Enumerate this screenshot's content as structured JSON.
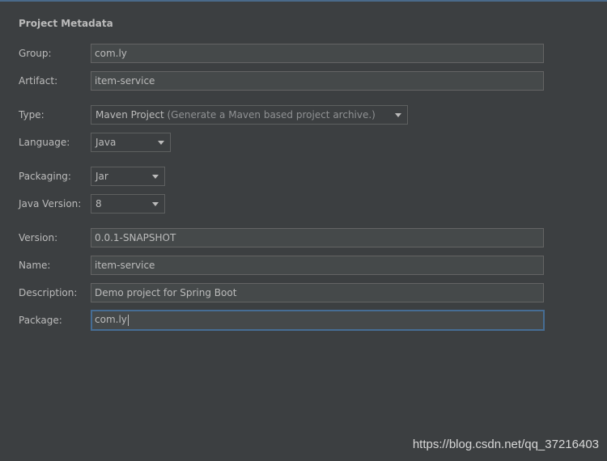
{
  "section_title": "Project Metadata",
  "fields": {
    "group": {
      "label": "Group:",
      "value": "com.ly"
    },
    "artifact": {
      "label": "Artifact:",
      "value": "item-service"
    },
    "type": {
      "label": "Type:",
      "value": "Maven Project",
      "hint": "(Generate a Maven based project archive.)"
    },
    "language": {
      "label": "Language:",
      "value": "Java"
    },
    "packaging": {
      "label": "Packaging:",
      "value": "Jar"
    },
    "java_version": {
      "label": "Java Version:",
      "value": "8"
    },
    "version": {
      "label": "Version:",
      "value": "0.0.1-SNAPSHOT"
    },
    "name": {
      "label": "Name:",
      "value": "item-service"
    },
    "description": {
      "label": "Description:",
      "value": "Demo project for Spring Boot"
    },
    "package": {
      "label": "Package:",
      "value": "com.ly"
    }
  },
  "watermark": "https://blog.csdn.net/qq_37216403",
  "colors": {
    "background": "#3c3f41",
    "field_background": "#45494a",
    "focus_border": "#466d94",
    "text": "#bbbbbb"
  }
}
